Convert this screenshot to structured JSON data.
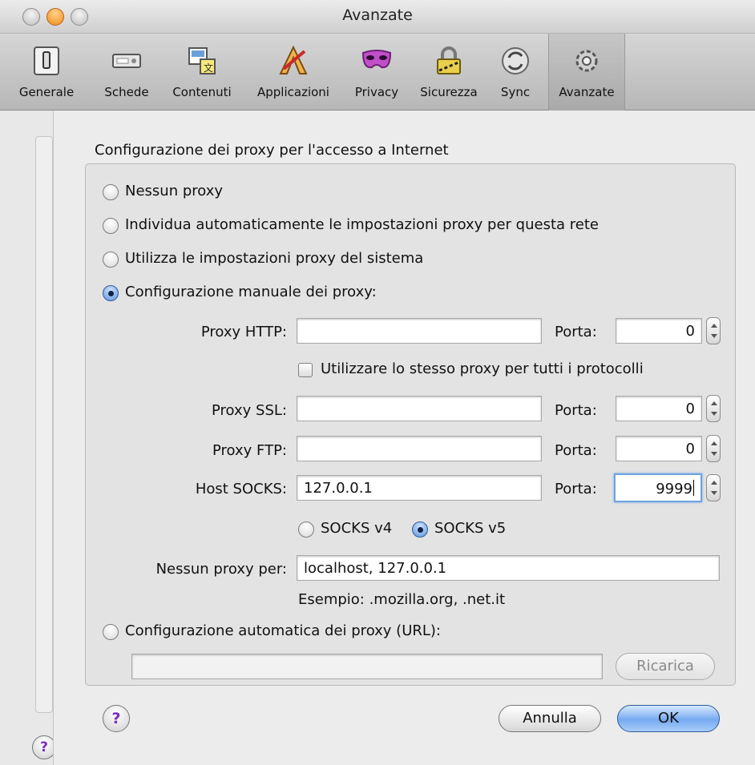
{
  "window": {
    "title": "Avanzate"
  },
  "toolbar": {
    "items": [
      {
        "label": "Generale",
        "icon": "switch-icon"
      },
      {
        "label": "Schede",
        "icon": "tabs-icon"
      },
      {
        "label": "Contenuti",
        "icon": "content-icon"
      },
      {
        "label": "Applicazioni",
        "icon": "applications-icon"
      },
      {
        "label": "Privacy",
        "icon": "mask-icon"
      },
      {
        "label": "Sicurezza",
        "icon": "lock-icon"
      },
      {
        "label": "Sync",
        "icon": "sync-icon"
      },
      {
        "label": "Avanzate",
        "icon": "gear-icon"
      }
    ],
    "selected": "Avanzate"
  },
  "dialog": {
    "section_title": "Configurazione dei proxy per l'accesso a Internet",
    "options": {
      "no_proxy": "Nessun proxy",
      "auto_detect": "Individua automaticamente le impostazioni proxy per questa rete",
      "system": "Utilizza le impostazioni proxy del sistema",
      "manual": "Configurazione manuale dei proxy:",
      "pac": "Configurazione automatica dei proxy (URL):"
    },
    "selected_option": "manual",
    "http": {
      "label": "Proxy HTTP:",
      "value": "",
      "port_label": "Porta:",
      "port": "0"
    },
    "same_proxy": {
      "label": "Utilizzare lo stesso proxy per tutti i protocolli",
      "checked": false
    },
    "ssl": {
      "label": "Proxy SSL:",
      "value": "",
      "port_label": "Porta:",
      "port": "0"
    },
    "ftp": {
      "label": "Proxy FTP:",
      "value": "",
      "port_label": "Porta:",
      "port": "0"
    },
    "socks": {
      "label": "Host SOCKS:",
      "value": "127.0.0.1",
      "port_label": "Porta:",
      "port": "9999"
    },
    "socks_version": {
      "v4": "SOCKS v4",
      "v5": "SOCKS v5",
      "selected": "v5"
    },
    "no_proxy_for": {
      "label": "Nessun proxy per:",
      "value": "localhost, 127.0.0.1"
    },
    "example": "Esempio: .mozilla.org, .net.it",
    "pac_url": "",
    "reload_button": "Ricarica",
    "cancel_button": "Annulla",
    "ok_button": "OK",
    "help_glyph": "?"
  },
  "colors": {
    "accent": "#5e95dc",
    "focus_ring": "#6fa3e0",
    "help": "#7a2bbf"
  }
}
